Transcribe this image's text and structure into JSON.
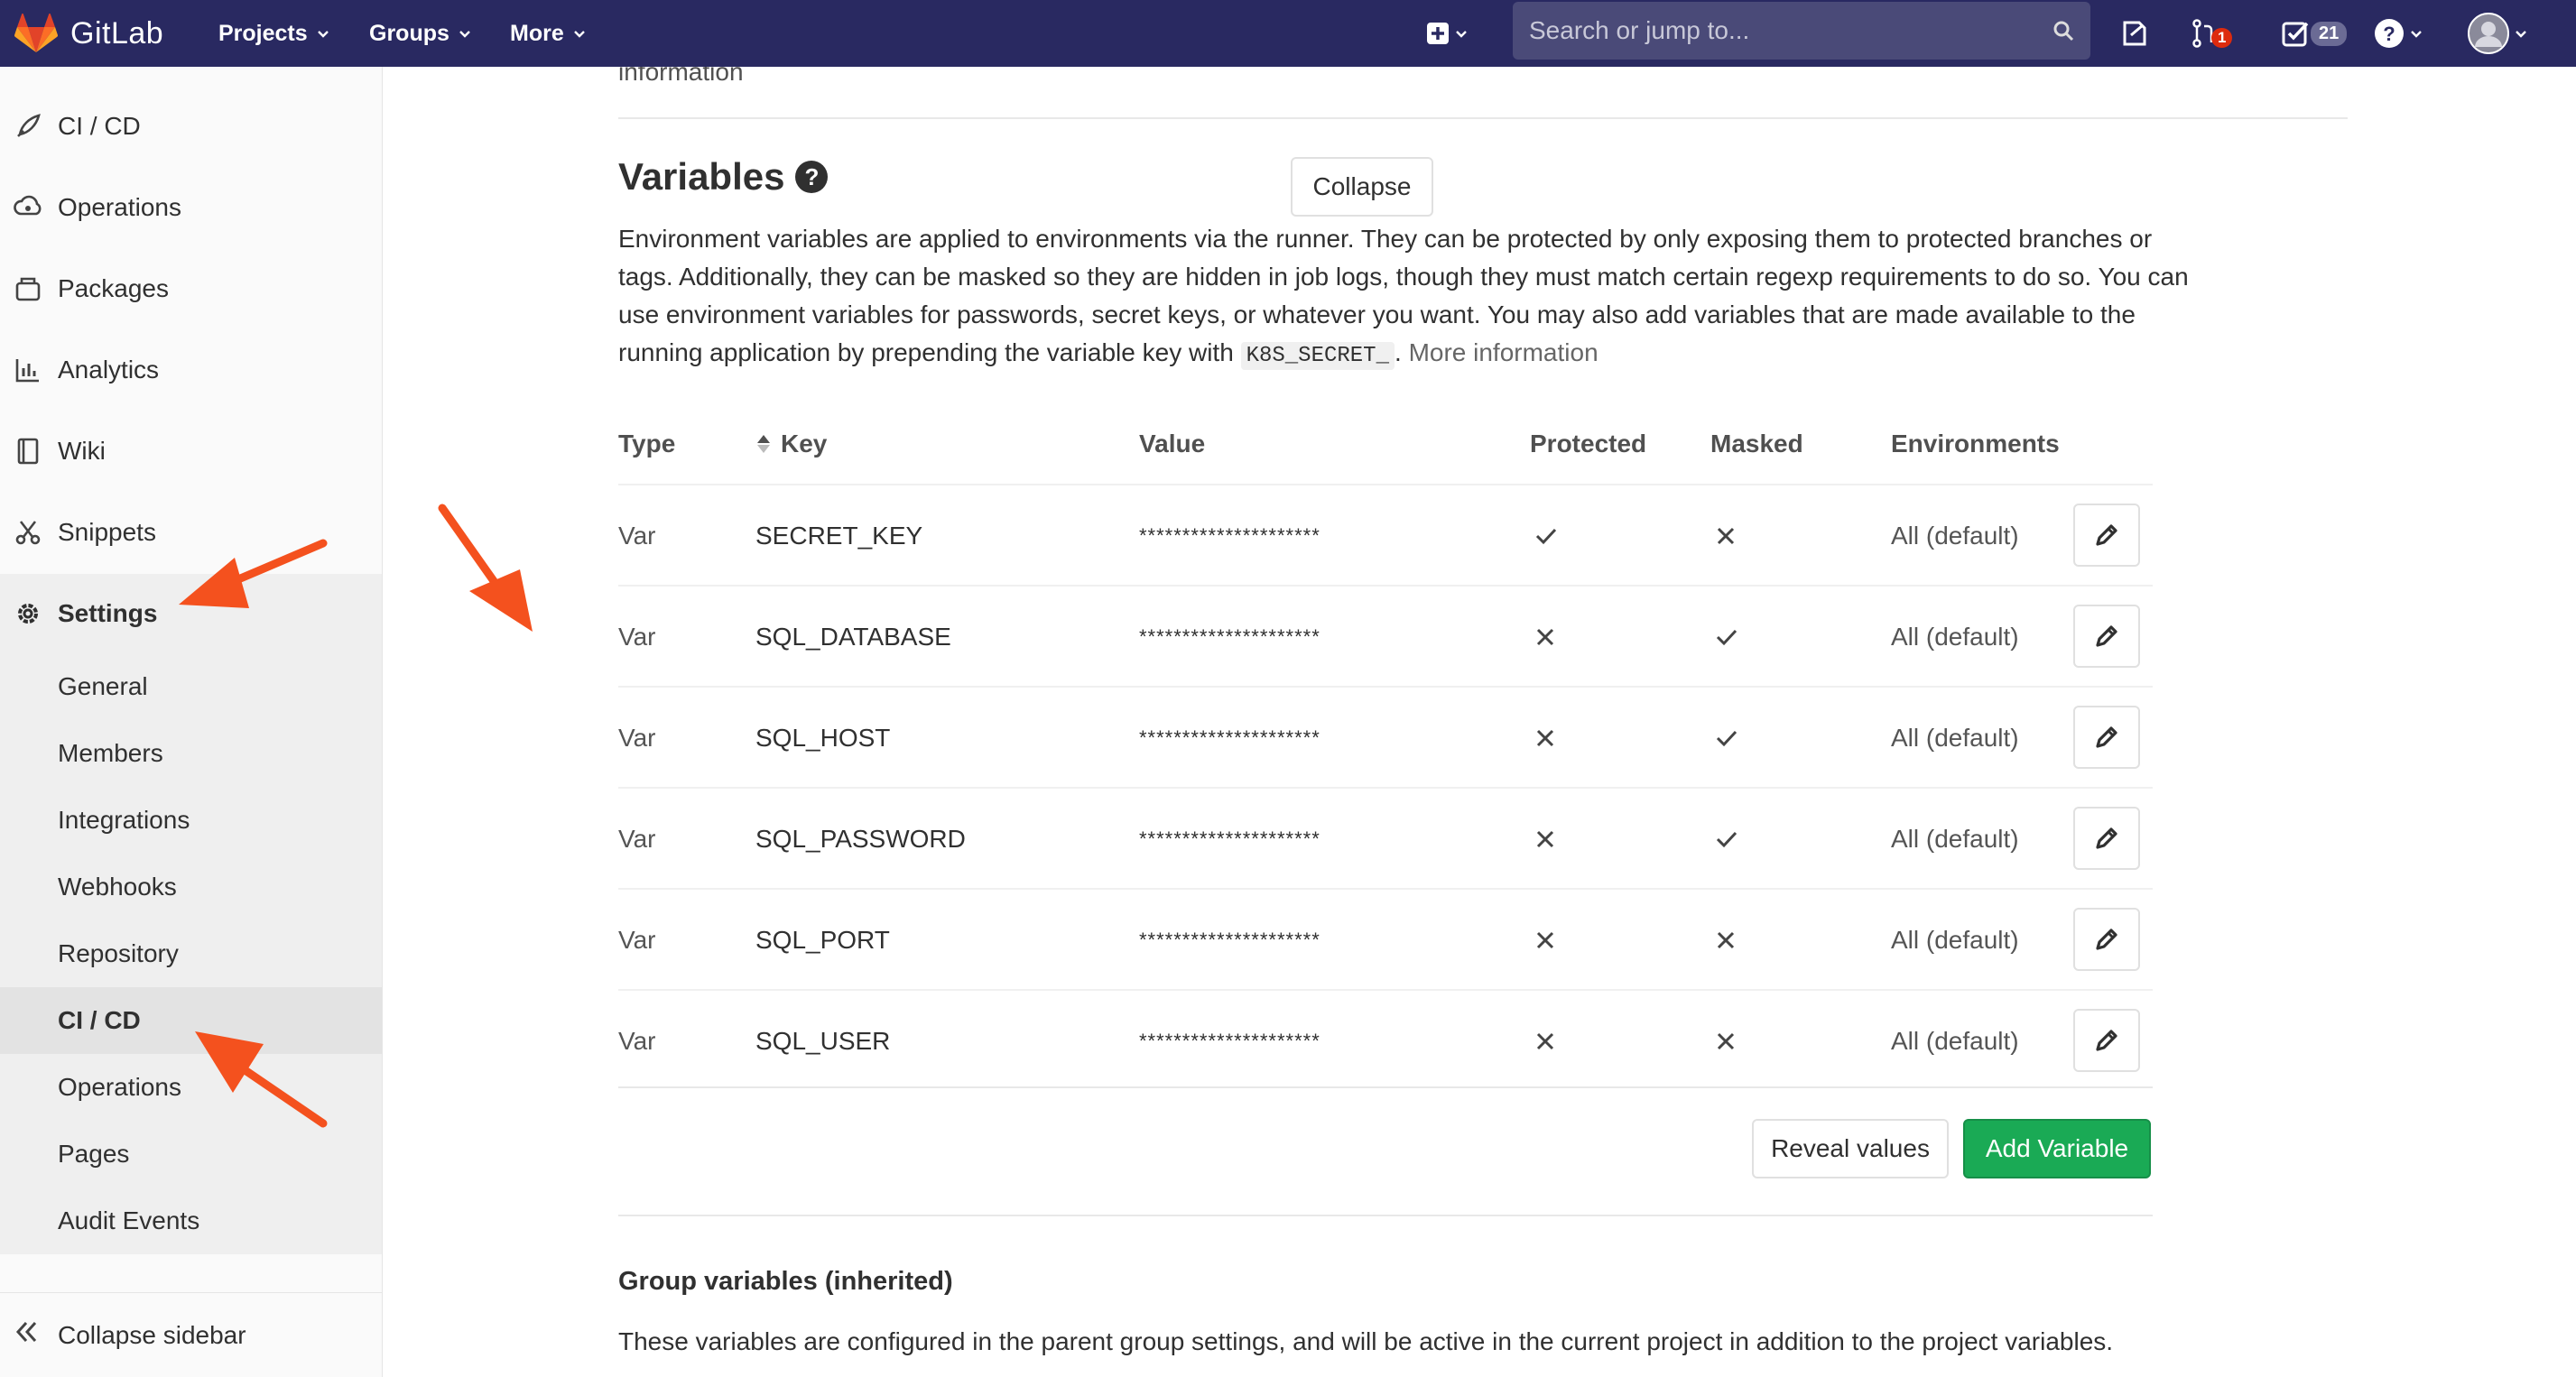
{
  "navbar": {
    "brand": "GitLab",
    "projects": "Projects",
    "groups": "Groups",
    "more": "More",
    "search_placeholder": "Search or jump to...",
    "merge_requests_count": "1",
    "todos_count": "21"
  },
  "sidebar": {
    "items": [
      {
        "label": "CI / CD",
        "icon": "rocket-icon"
      },
      {
        "label": "Operations",
        "icon": "cloud-gear-icon"
      },
      {
        "label": "Packages",
        "icon": "package-icon"
      },
      {
        "label": "Analytics",
        "icon": "chart-icon"
      },
      {
        "label": "Wiki",
        "icon": "book-icon"
      },
      {
        "label": "Snippets",
        "icon": "scissors-icon"
      },
      {
        "label": "Settings",
        "icon": "gear-icon"
      }
    ],
    "settings_sub": [
      "General",
      "Members",
      "Integrations",
      "Webhooks",
      "Repository",
      "CI / CD",
      "Operations",
      "Pages",
      "Audit Events"
    ],
    "collapse": "Collapse sidebar"
  },
  "main": {
    "prev_section": "information",
    "title": "Variables",
    "collapse_button": "Collapse",
    "description_1": "Environment variables are applied to environments via the runner. They can be protected by only exposing them to protected branches or tags. Additionally, they can be masked so they are hidden in job logs, though they must match certain regexp requirements to do so. You can use environment variables for passwords, secret keys, or whatever you want. You may also add variables that are made available to the running application by prepending the variable key with ",
    "description_code": "K8S_SECRET_",
    "description_2": ". ",
    "more_info": "More information",
    "table": {
      "headers": {
        "type": "Type",
        "key": "Key",
        "value": "Value",
        "protected": "Protected",
        "masked": "Masked",
        "environments": "Environments"
      },
      "rows": [
        {
          "type": "Var",
          "key": "SECRET_KEY",
          "value": "*********************",
          "protected": true,
          "masked": false,
          "env": "All (default)"
        },
        {
          "type": "Var",
          "key": "SQL_DATABASE",
          "value": "*********************",
          "protected": false,
          "masked": true,
          "env": "All (default)"
        },
        {
          "type": "Var",
          "key": "SQL_HOST",
          "value": "*********************",
          "protected": false,
          "masked": true,
          "env": "All (default)"
        },
        {
          "type": "Var",
          "key": "SQL_PASSWORD",
          "value": "*********************",
          "protected": false,
          "masked": true,
          "env": "All (default)"
        },
        {
          "type": "Var",
          "key": "SQL_PORT",
          "value": "*********************",
          "protected": false,
          "masked": false,
          "env": "All (default)"
        },
        {
          "type": "Var",
          "key": "SQL_USER",
          "value": "*********************",
          "protected": false,
          "masked": false,
          "env": "All (default)"
        }
      ]
    },
    "reveal_button": "Reveal values",
    "add_button": "Add Variable",
    "group_title": "Group variables (inherited)",
    "group_desc": "These variables are configured in the parent group settings, and will be active in the current project in addition to the project variables."
  },
  "colors": {
    "navbar": "#292961",
    "accent_green": "#1aaa55",
    "annotation_arrow": "#f4511e",
    "badge_red": "#dd2b0e"
  }
}
